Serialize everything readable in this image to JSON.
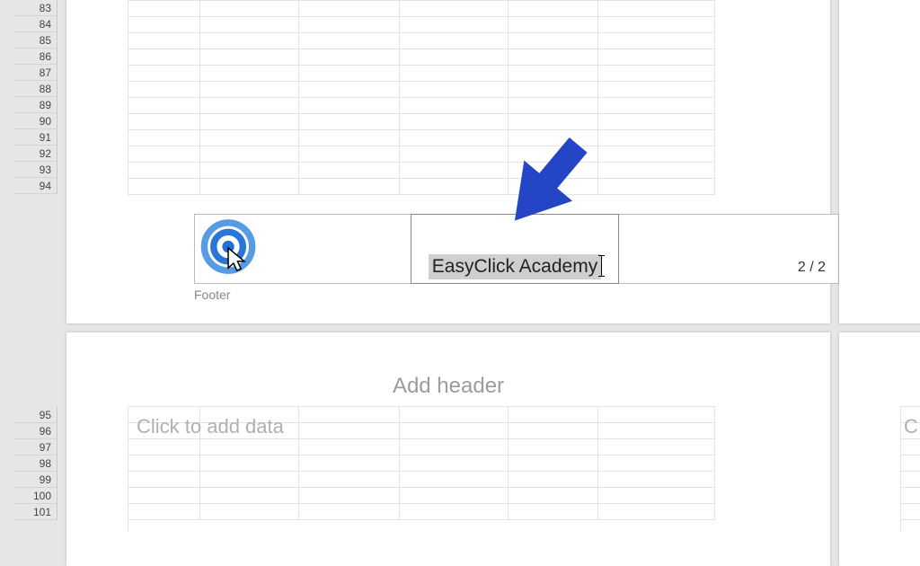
{
  "rows_top": [
    "83",
    "84",
    "85",
    "86",
    "87",
    "88",
    "89",
    "90",
    "91",
    "92",
    "93",
    "94"
  ],
  "rows_bottom": [
    "95",
    "96",
    "97",
    "98",
    "99",
    "100",
    "101"
  ],
  "footer": {
    "label": "Footer",
    "center_text": "EasyClick Academy",
    "right_text": "2 / 2"
  },
  "page2": {
    "header_placeholder": "Add header",
    "data_placeholder": "Click to add data",
    "right_partial": "C"
  },
  "annotation": {
    "arrow_color": "#2446c6",
    "click_color": "#1f6fd4"
  }
}
